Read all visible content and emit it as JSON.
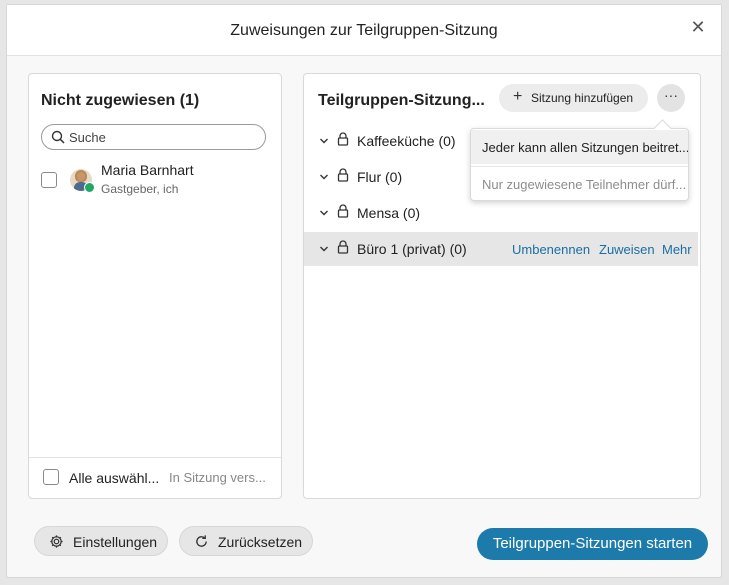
{
  "dialog": {
    "title": "Zuweisungen zur Teilgruppen-Sitzung"
  },
  "left_panel": {
    "title": "Nicht zugewiesen (1)",
    "search_placeholder": "Suche",
    "users": [
      {
        "name": "Maria Barnhart",
        "role": "Gastgeber, ich"
      }
    ],
    "select_all_label": "Alle auswähl...",
    "move_to_label": "In Sitzung vers..."
  },
  "right_panel": {
    "title": "Teilgruppen-Sitzung...",
    "add_session_label": "Sitzung hinzufügen",
    "more_label": "···",
    "sessions": [
      {
        "name": "Kaffeeküche (0)"
      },
      {
        "name": "Flur (0)"
      },
      {
        "name": "Mensa (0)"
      },
      {
        "name": "Büro 1 (privat) (0)",
        "actions": [
          "Umbenennen",
          "Zuweisen",
          "Mehr"
        ]
      }
    ]
  },
  "dropdown": {
    "items": [
      {
        "label": "Jeder kann allen Sitzungen beitret..."
      },
      {
        "label": "Nur zugewiesene Teilnehmer dürf..."
      }
    ]
  },
  "footer": {
    "settings_label": "Einstellungen",
    "reset_label": "Zurücksetzen",
    "start_label": "Teilgruppen-Sitzungen starten"
  },
  "colors": {
    "accent": "#1d7bab",
    "link": "#1a6fa0"
  }
}
